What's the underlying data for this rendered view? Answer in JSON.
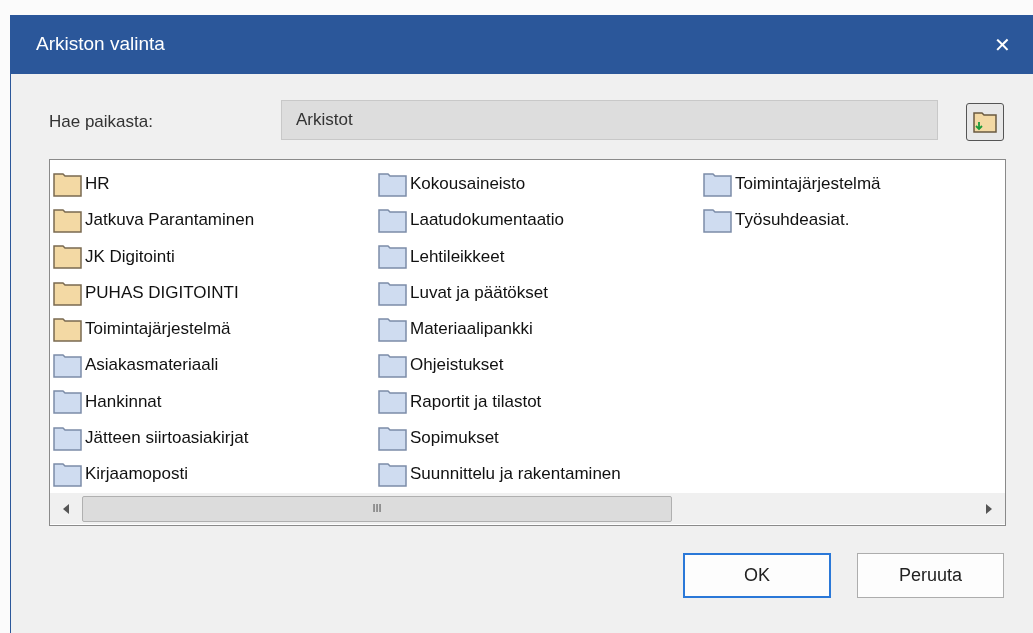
{
  "window": {
    "title": "Arkiston valinta",
    "close": "✕"
  },
  "location": {
    "label": "Hae paikasta:",
    "value": "Arkistot"
  },
  "items": [
    {
      "name": "HR",
      "kind": "folder"
    },
    {
      "name": "Jatkuva Parantaminen",
      "kind": "folder"
    },
    {
      "name": "JK Digitointi",
      "kind": "folder"
    },
    {
      "name": "PUHAS DIGITOINTI",
      "kind": "folder"
    },
    {
      "name": "Toimintajärjestelmä",
      "kind": "folder"
    },
    {
      "name": "Asiakasmateriaali",
      "kind": "archive"
    },
    {
      "name": "Hankinnat",
      "kind": "archive"
    },
    {
      "name": "Jätteen siirtoasiakirjat",
      "kind": "archive"
    },
    {
      "name": "Kirjaamoposti",
      "kind": "archive"
    },
    {
      "name": "Kokousaineisto",
      "kind": "archive"
    },
    {
      "name": "Laatudokumentaatio",
      "kind": "archive"
    },
    {
      "name": "Lehtileikkeet",
      "kind": "archive"
    },
    {
      "name": "Luvat ja päätökset",
      "kind": "archive"
    },
    {
      "name": "Materiaalipankki",
      "kind": "archive"
    },
    {
      "name": "Ohjeistukset",
      "kind": "archive"
    },
    {
      "name": "Raportit ja tilastot",
      "kind": "archive"
    },
    {
      "name": "Sopimukset",
      "kind": "archive"
    },
    {
      "name": "Suunnittelu ja rakentaminen",
      "kind": "archive"
    },
    {
      "name": "Toimintajärjestelmä",
      "kind": "archive"
    },
    {
      "name": "Työsuhdeasiat.",
      "kind": "archive"
    }
  ],
  "scrollbar": {
    "grip": "III"
  },
  "buttons": [
    {
      "label": "OK",
      "default": true
    },
    {
      "label": "Peruuta",
      "default": false
    }
  ]
}
